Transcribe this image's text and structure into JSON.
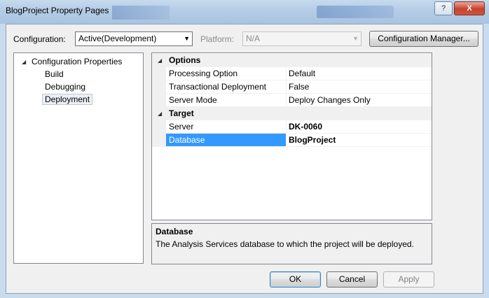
{
  "window": {
    "title": "BlogProject Property Pages",
    "help_label": "?",
    "close_label": "X"
  },
  "toolbar": {
    "configuration_label": "Configuration:",
    "configuration_value": "Active(Development)",
    "platform_label": "Platform:",
    "platform_value": "N/A",
    "config_manager_label": "Configuration Manager..."
  },
  "tree": {
    "root": "Configuration Properties",
    "items": [
      {
        "label": "Build"
      },
      {
        "label": "Debugging"
      },
      {
        "label": "Deployment",
        "selected": true
      }
    ]
  },
  "grid": {
    "categories": [
      {
        "name": "Options",
        "rows": [
          {
            "name": "Processing Option",
            "value": "Default"
          },
          {
            "name": "Transactional Deployment",
            "value": "False"
          },
          {
            "name": "Server Mode",
            "value": "Deploy Changes Only"
          }
        ]
      },
      {
        "name": "Target",
        "rows": [
          {
            "name": "Server",
            "value": "DK-0060"
          },
          {
            "name": "Database",
            "value": "BlogProject",
            "selected": true
          }
        ]
      }
    ]
  },
  "description": {
    "title": "Database",
    "text": "The Analysis Services database to which the project will be deployed."
  },
  "buttons": {
    "ok": "OK",
    "cancel": "Cancel",
    "apply": "Apply"
  },
  "colors": {
    "selection": "#3399ff",
    "dialog_bg": "#f0f0f0"
  }
}
